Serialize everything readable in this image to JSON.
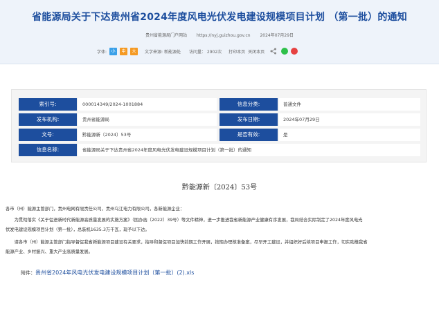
{
  "header": {
    "title": "省能源局关于下达贵州省2024年度风电光伏发电建设规模项目计划 （第一批）的通知",
    "source_label": "贵州省能源局门户网站",
    "url_text": "https://nyj.guizhou.gov.cn",
    "date_text": "2024年07月29日",
    "font_label": "字体:",
    "font_small": "小",
    "font_mid": "中",
    "font_big": "大",
    "source_text": "文字来源: 新能源处",
    "visits_text": "访问量： 2902次",
    "print_text": "打印本页",
    "close_text": "关闭本页"
  },
  "info": {
    "index_label": "索引号:",
    "index_value": "000014349/2024-1001884",
    "category_label": "信息分类:",
    "category_value": "普通文件",
    "org_label": "发布机构:",
    "org_value": "贵州省能源局",
    "date_label": "发布日期:",
    "date_value": "2024年07月29日",
    "docno_label": "文号:",
    "docno_value": "黔能源新〔2024〕53号",
    "valid_label": "是否有效:",
    "valid_value": "是",
    "name_label": "信息名称:",
    "name_value": "省能源局关于下达贵州省2024年度风电光伏发电建设规模项目计划（第一批）的通知"
  },
  "doc": {
    "number": "黔能源新〔2024〕53号",
    "salutation": "各市（州）能源主管部门，贵州电网有限责任公司，贵州乌江电力有限公司，各新能源企业：",
    "para1_line1": "　　为贯彻落实《关于促进新时代新能源高质量发展的实施方案》（国办函〔2022〕39号）等文件精神，进一步推进我省新能源产业健康有序发展，我局结合实际制定了2024年度风电光",
    "para1_line2": "伏发电建设规模项目计划（第一批），总装机1635.3万千瓦，现予以下达。",
    "para2_line1": "　　请各市（州）能源主管部门指导督促我省新能源项目建设有关要求，指导和督促项目加快前期工作开展，按期办理核准备案，尽早开工建设，并组织好后续项目申报工作，切实助推我省",
    "para2_line2": "能源产业、乡村振兴、重大产业高质量发展。",
    "attach_label": "附件：",
    "attach_link": "贵州省2024年风电光伏发电建设规模项目计划（第一批）(2).xls"
  }
}
